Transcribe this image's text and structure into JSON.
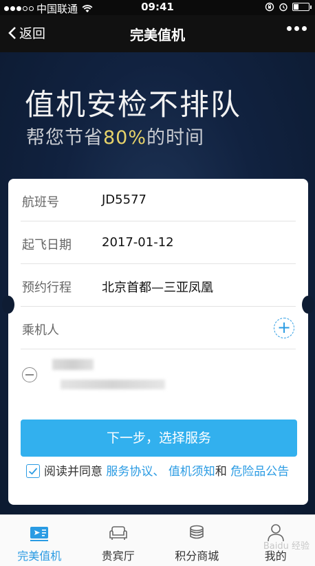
{
  "status_bar": {
    "carrier": "中国联通",
    "time": "09:41",
    "signal_bars_filled": 3,
    "signal_bars_total": 5,
    "battery_level": 0.3
  },
  "nav": {
    "back_label": "返回",
    "title": "完美值机"
  },
  "hero": {
    "title": "值机安检不排队",
    "subtitle_pre": "帮您节省",
    "subtitle_highlight": "80%",
    "subtitle_post": "的时间",
    "highlight_color": "#e7d36a"
  },
  "form": {
    "rows": [
      {
        "label": "航班号",
        "value": "JD5577"
      },
      {
        "label": "起飞日期",
        "value": "2017-01-12"
      },
      {
        "label": "预约行程",
        "value": "北京首都—三亚凤凰"
      }
    ],
    "passenger_label": "乘机人",
    "next_button": "下一步，选择服务",
    "agree_prefix": "阅读并同意",
    "link_service": "服务协议、",
    "link_checkin": "值机须知",
    "agree_and": "和",
    "link_danger": "危险品公告"
  },
  "tabbar": {
    "items": [
      {
        "label": "完美值机",
        "icon": "boarding-pass-icon",
        "active": true
      },
      {
        "label": "贵宾厅",
        "icon": "sofa-icon",
        "active": false
      },
      {
        "label": "积分商城",
        "icon": "coins-icon",
        "active": false
      },
      {
        "label": "我的",
        "icon": "user-icon",
        "active": false
      }
    ],
    "watermark": "Baidu 经验"
  },
  "colors": {
    "accent": "#2a9be3",
    "button": "#32b0ee",
    "hero_bg": "#112240"
  }
}
